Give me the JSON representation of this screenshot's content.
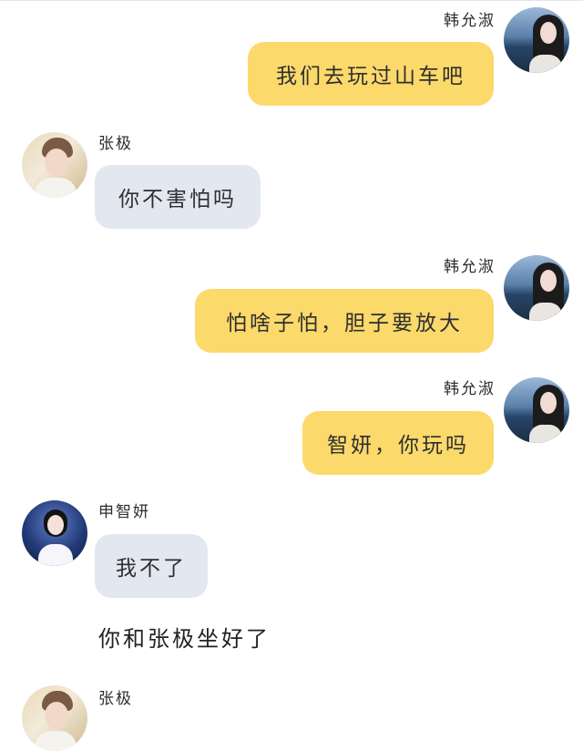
{
  "messages": [
    {
      "sender": "韩允淑",
      "text": "我们去玩过山车吧"
    },
    {
      "sender": "张极",
      "text": "你不害怕吗"
    },
    {
      "sender": "韩允淑",
      "text": "怕啥子怕，胆子要放大"
    },
    {
      "sender": "韩允淑",
      "text": "智妍，你玩吗"
    },
    {
      "sender": "申智妍",
      "text": "我不了"
    },
    {
      "narration": "你和张极坐好了"
    },
    {
      "sender": "张极"
    }
  ],
  "colors": {
    "self_bubble": "#fcd96b",
    "other_bubble": "#e2e7f0"
  }
}
